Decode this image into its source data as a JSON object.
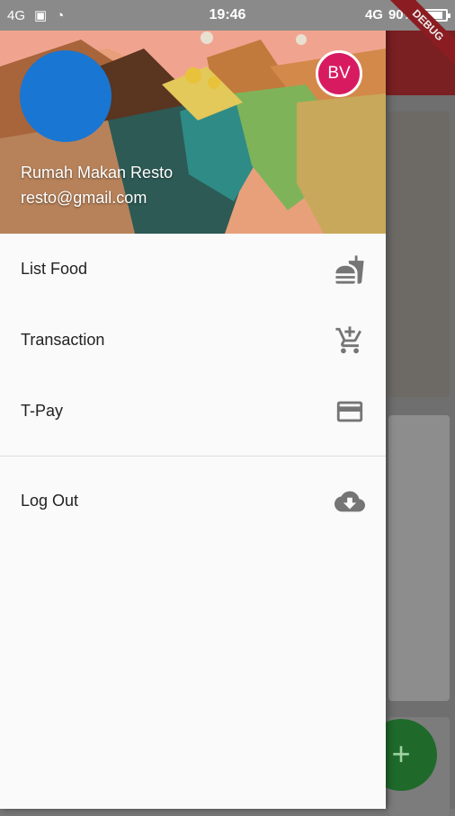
{
  "status_bar": {
    "left_icons": [
      "signal-4g",
      "sim-icon",
      "nfc-icon"
    ],
    "network_left": "4G",
    "time": "19:46",
    "network_right": "4G",
    "battery": "90%",
    "battery_level": 0.9
  },
  "debug_banner": "DEBUG",
  "drawer": {
    "header": {
      "avatar_initials": "BV",
      "account_name": "Rumah Makan Resto",
      "account_email": "resto@gmail.com"
    },
    "items": [
      {
        "label": "List Food",
        "icon": "fastfood-icon"
      },
      {
        "label": "Transaction",
        "icon": "add-shopping-cart-icon"
      },
      {
        "label": "T-Pay",
        "icon": "credit-card-icon"
      }
    ],
    "logout": {
      "label": "Log Out",
      "icon": "cloud-download-icon"
    }
  },
  "fab_label": "+",
  "colors": {
    "app_bar": "#c62828",
    "avatar": "#1976d2",
    "mini_avatar": "#d81b60",
    "fab": "#2e7d32"
  }
}
